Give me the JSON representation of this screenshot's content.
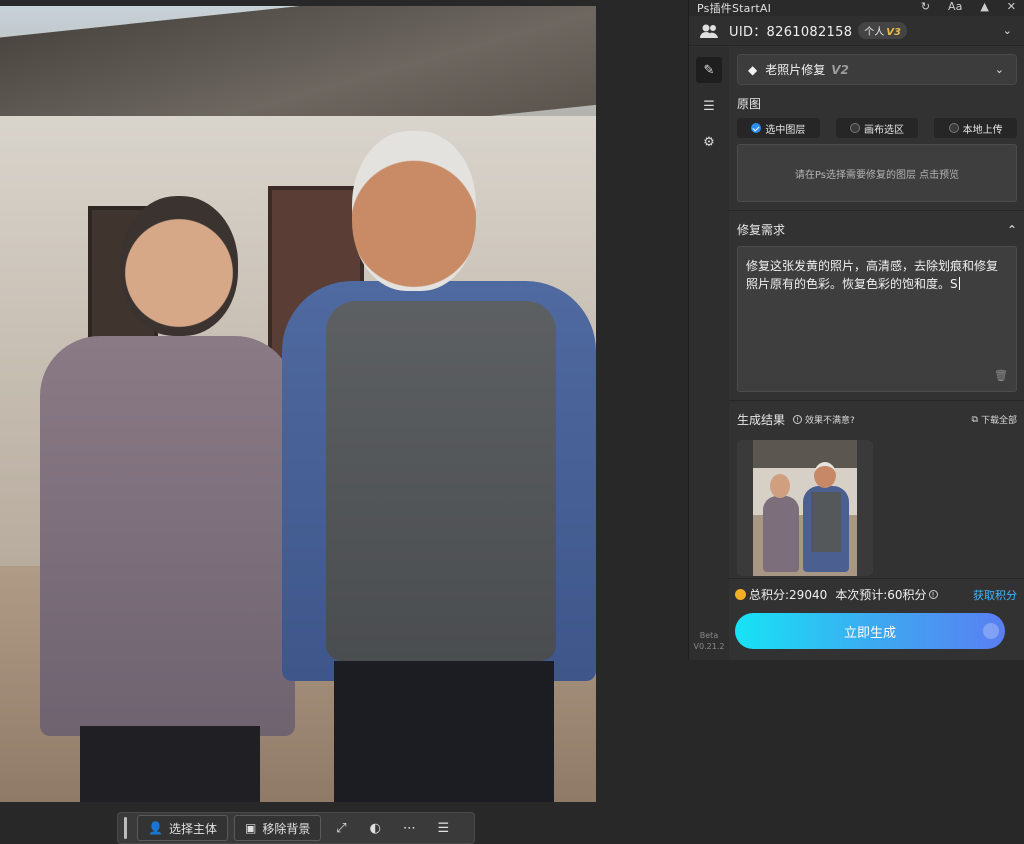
{
  "panel": {
    "title": "Ps插件StartAI",
    "uid_label": "UID：8261082158",
    "plan": "个人",
    "plan_level": "V3",
    "version_beta": "Beta",
    "version_num": "V0.21.2"
  },
  "mode": {
    "name": "老照片修复",
    "version": "V2"
  },
  "source": {
    "label": "原图",
    "tabs": [
      "选中图层",
      "画布选区",
      "本地上传"
    ],
    "selected_index": 0,
    "hint": "请在Ps选择需要修复的图层 点击预览"
  },
  "requirement": {
    "label": "修复需求",
    "text": "修复这张发黄的照片，高清感，去除划痕和修复照片原有的色彩。恢复色彩的饱和度。S"
  },
  "result": {
    "label": "生成结果",
    "unsatisfied": "效果不满意?",
    "download_all": "下载全部"
  },
  "footer": {
    "total_points": "总积分:29040",
    "estimate": "本次预计:60积分",
    "get_points": "获取积分",
    "generate": "立即生成"
  },
  "toolbar": {
    "select_subject": "选择主体",
    "remove_background": "移除背景"
  },
  "colors": {
    "accent": "#3fb8ff",
    "coin": "#f2b024",
    "radio_on": "#2d8cf0"
  }
}
